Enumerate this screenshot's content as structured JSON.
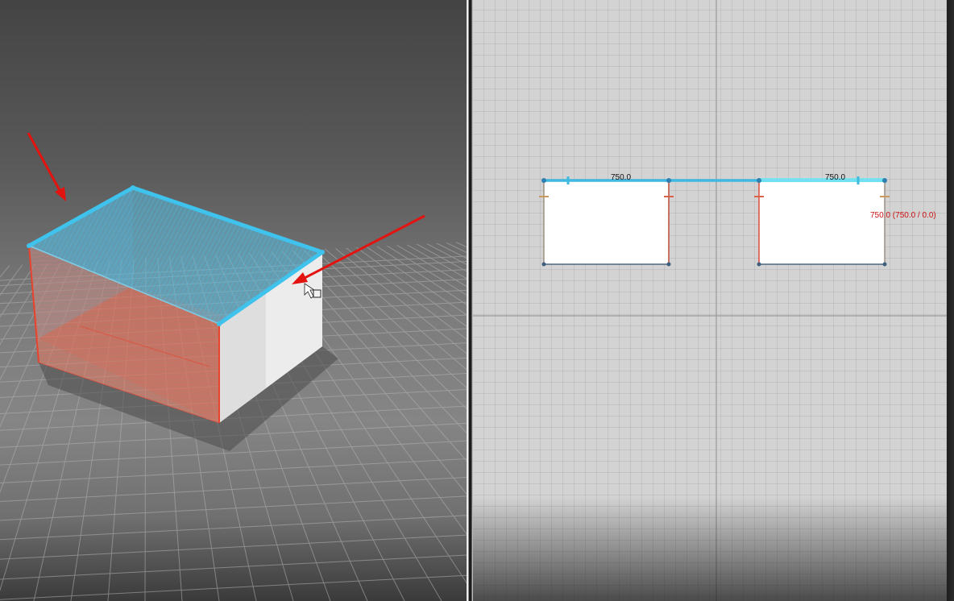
{
  "viewport_2d": {
    "dimension_left": "750.0",
    "dimension_right": "750.0",
    "dimension_live": "750.0 (750.0 / 0.0)"
  },
  "colors": {
    "selection": "#3fb9e0",
    "edge_red": "#e8432f",
    "arrow": "#e3130f",
    "grid_bg": "#d3d3d3"
  },
  "icons": {
    "cursor": "move-cursor-icon",
    "arrow_1": "annotation-arrow-icon",
    "arrow_2": "annotation-arrow-icon"
  }
}
